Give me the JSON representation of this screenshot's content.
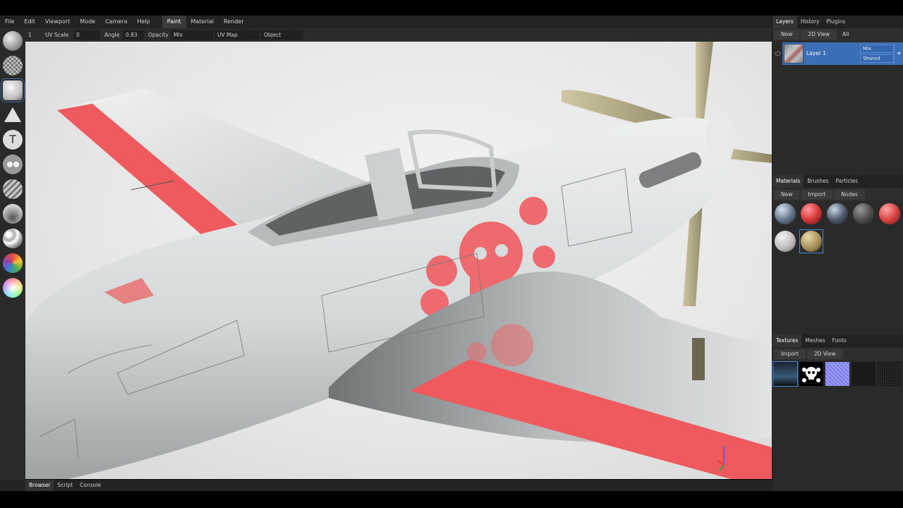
{
  "menu": {
    "items": [
      "File",
      "Edit",
      "Viewport",
      "Mode",
      "Camera",
      "Help"
    ],
    "modes": [
      "Paint",
      "Material",
      "Render"
    ],
    "active_mode": "Paint"
  },
  "toolbar": {
    "brush_index": "1",
    "uv_scale_label": "UV Scale",
    "uv_scale_value": "0",
    "angle_label": "Angle",
    "angle_value": "0.83",
    "opacity_label": "Opacity",
    "blend_value": "Mix",
    "uv_map_value": "UV Map",
    "object_value": "Object"
  },
  "tools": [
    "brush-tool-icon",
    "eraser-checker-icon",
    "fill-sphere-icon",
    "cone-shape-icon",
    "text-tool-icon",
    "particle-tool-icon",
    "stripe-tool-icon",
    "clone-tool-icon",
    "blur-tool-icon",
    "color-wheel-icon",
    "swatch-icon"
  ],
  "layers_panel": {
    "tabs": [
      "Layers",
      "History",
      "Plugins"
    ],
    "active_tab": "Layers",
    "buttons": [
      "New",
      "2D View",
      "All"
    ],
    "layer": {
      "name": "Layer 1",
      "blend": "Mix",
      "mode": "Shared",
      "add": "+"
    }
  },
  "materials_panel": {
    "tabs": [
      "Materials",
      "Brushes",
      "Particles"
    ],
    "active_tab": "Materials",
    "buttons": [
      "New",
      "Import",
      "Nodes"
    ]
  },
  "textures_panel": {
    "tabs": [
      "Textures",
      "Meshes",
      "Fonts"
    ],
    "active_tab": "Textures",
    "buttons": [
      "Import",
      "2D View"
    ]
  },
  "bottom": {
    "tabs": [
      "Browser",
      "Script",
      "Console"
    ],
    "active_tab": "Browser"
  },
  "colors": {
    "accent": "#3a6eb5",
    "panel_bg": "#2a2a2a",
    "paint_red": "#ee5a5e",
    "plane_body": "#d9dcdc"
  }
}
